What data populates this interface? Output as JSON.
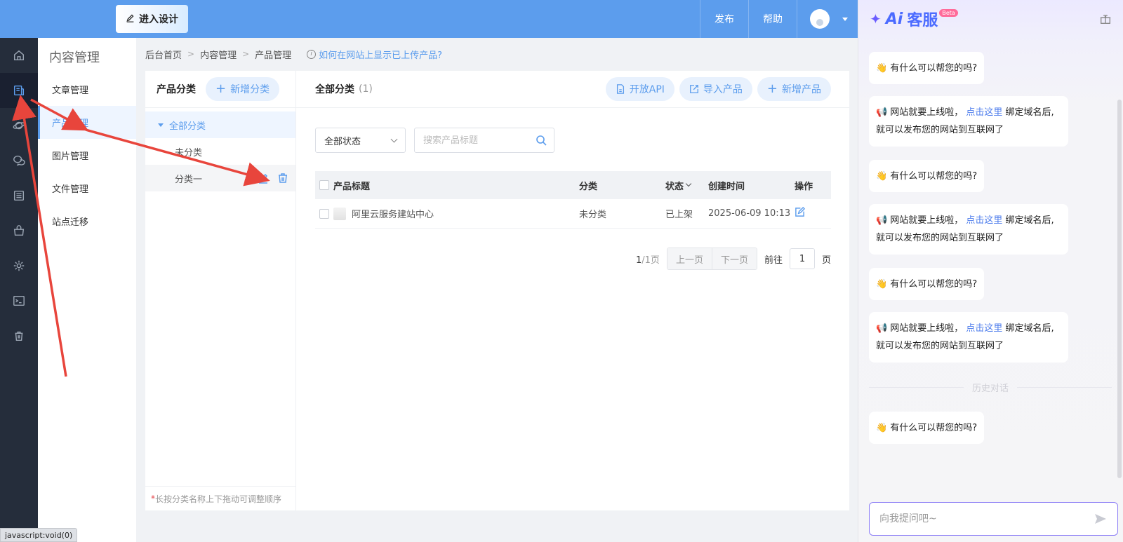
{
  "topbar": {
    "design_button": "进入设计",
    "menu": [
      "发布",
      "帮助"
    ]
  },
  "rail": {
    "icons": [
      "home-icon",
      "content-icon",
      "planet-icon",
      "chat-icon",
      "list-icon",
      "shop-icon",
      "gear-icon",
      "terminal-icon",
      "trash-icon"
    ],
    "active_index": 1
  },
  "subnav": {
    "title": "内容管理",
    "items": [
      "文章管理",
      "产品管理",
      "图片管理",
      "文件管理",
      "站点迁移"
    ],
    "active_index": 1
  },
  "breadcrumb": {
    "items": [
      "后台首页",
      "内容管理",
      "产品管理"
    ],
    "tip": "如何在网站上显示已上传产品?"
  },
  "categories": {
    "title": "产品分类",
    "add_button": "新增分类",
    "all": "全部分类",
    "children": [
      "未分类",
      "分类一"
    ],
    "footer": "长按分类名称上下拖动可调整顺序"
  },
  "list": {
    "title": "全部分类",
    "count": "(1)",
    "actions": [
      "开放API",
      "导入产品",
      "新增产品"
    ],
    "status_select": "全部状态",
    "search_placeholder": "搜索产品标题",
    "columns": [
      "产品标题",
      "分类",
      "状态",
      "创建时间",
      "操作"
    ],
    "rows": [
      {
        "title": "阿里云服务建站中心",
        "category": "未分类",
        "status": "已上架",
        "created": "2025-06-09 10:13"
      }
    ],
    "pager": {
      "current": "1",
      "total": "/1页",
      "prev": "上一页",
      "next": "下一页",
      "goto": "前往",
      "page_value": "1",
      "page_unit": "页"
    }
  },
  "statusbar": "javascript:void(0)",
  "chat": {
    "brand_ai": "Ai",
    "brand_cs": "客服",
    "beta": "Beta",
    "greeting": "有什么可以帮您的吗?",
    "notice_prefix": "网站就要上线啦，",
    "notice_link": "点击这里",
    "notice_suffix": "绑定域名后,就可以发布您的网站到互联网了",
    "history_label": "历史对话",
    "input_placeholder": "向我提问吧~"
  },
  "colors": {
    "accent": "#5c9ded",
    "rail": "#252d3b",
    "annotation": "#e8453c"
  }
}
